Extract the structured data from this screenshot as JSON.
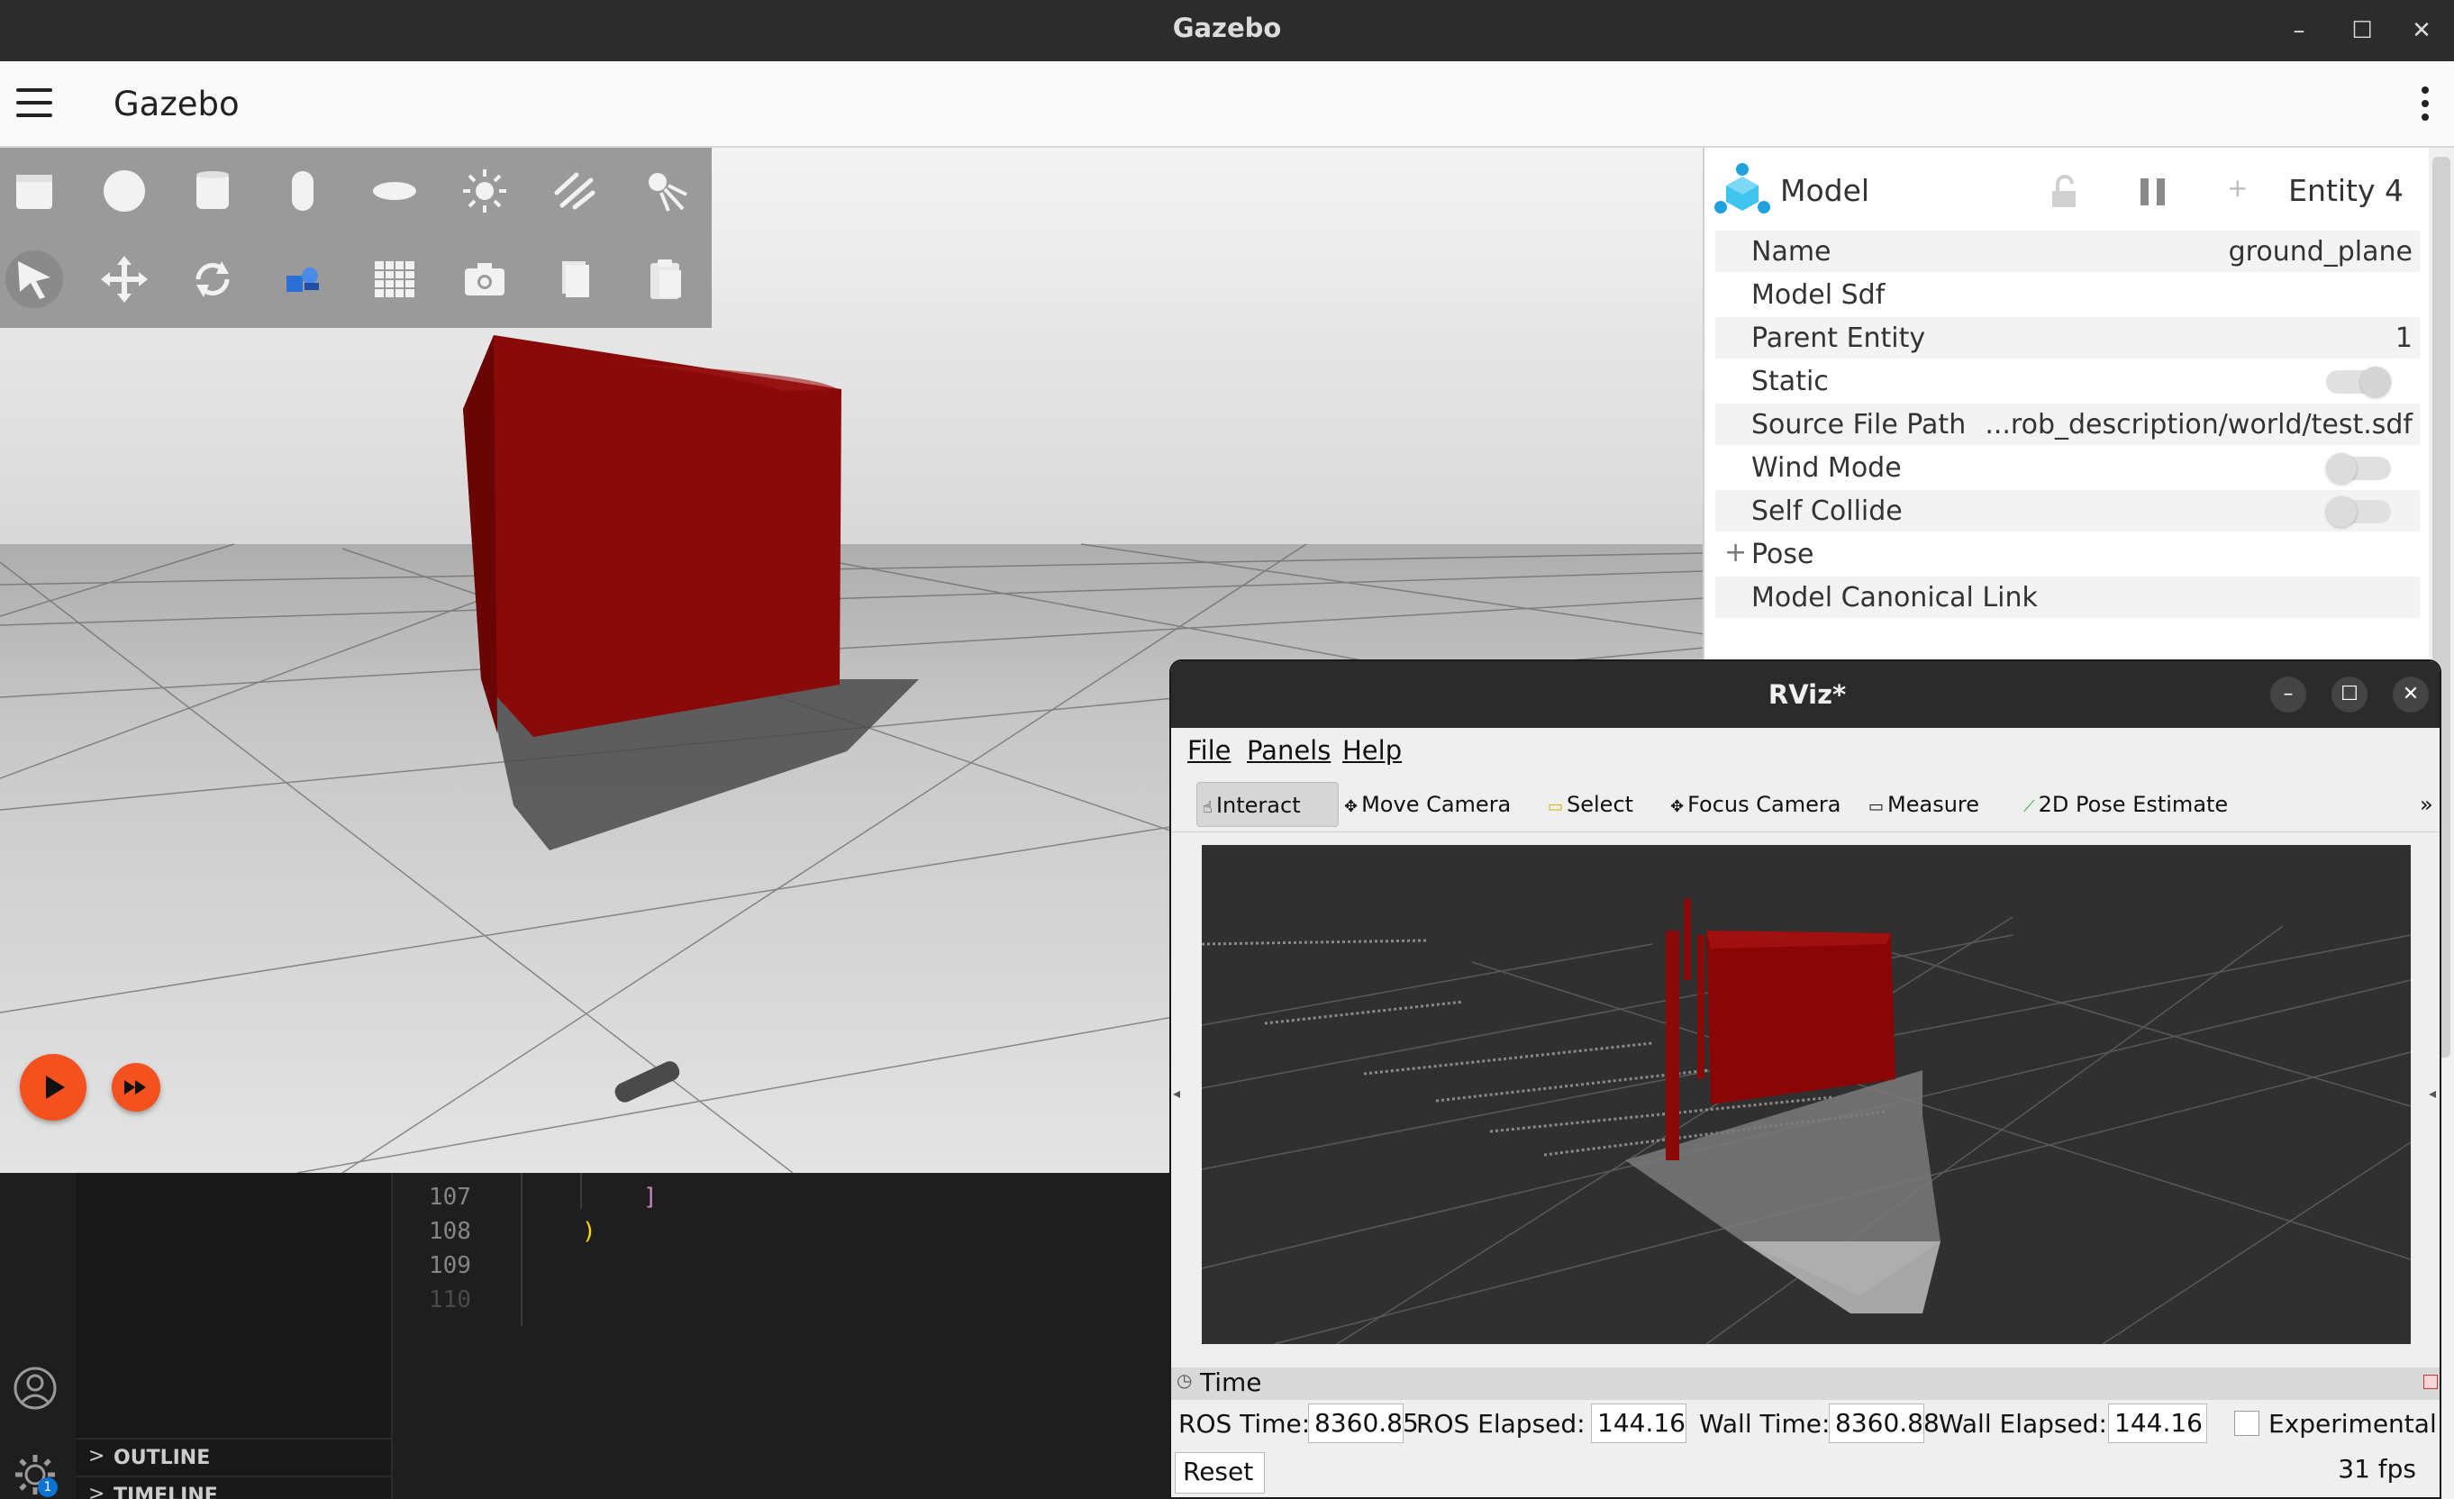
{
  "os_window": {
    "title": "Gazebo",
    "buttons": {
      "minimize": "–",
      "maximize": "☐",
      "close": "✕"
    }
  },
  "gazebo": {
    "app_title": "Gazebo",
    "toolbar_row1": [
      "box-icon",
      "sphere-icon",
      "cylinder-icon",
      "capsule-icon",
      "ellipsoid-icon",
      "sun-light-icon",
      "directional-light-icon",
      "spot-light-icon"
    ],
    "toolbar_row2": [
      "select-arrow-icon",
      "translate-icon",
      "rotate-icon",
      "transform-control-icon",
      "grid-icon",
      "screenshot-icon",
      "copy-icon",
      "paste-icon"
    ],
    "play": {
      "play_label": "▶",
      "step_label": "▸▸"
    },
    "accent_color": "#f4511e"
  },
  "entity_panel": {
    "header": {
      "type_label": "Model",
      "entity_label": "Entity 4",
      "add_label": "+"
    },
    "rows": [
      {
        "key": "Name",
        "value": "ground_plane"
      },
      {
        "key": "Model Sdf",
        "value": ""
      },
      {
        "key": "Parent Entity",
        "value": "1"
      },
      {
        "key": "Static",
        "value": ""
      },
      {
        "key": "Source File Path",
        "value": "...rob_description/world/test.sdf"
      },
      {
        "key": "Wind Mode",
        "value": ""
      },
      {
        "key": "Self Collide",
        "value": ""
      },
      {
        "key": "Pose",
        "value": ""
      },
      {
        "key": "Model Canonical Link",
        "value": ""
      }
    ],
    "pose_expander": "+",
    "toggles": {
      "static": true,
      "wind_mode": false,
      "self_collide": false
    }
  },
  "vscode": {
    "line_numbers": [
      "107",
      "108",
      "109",
      "110"
    ],
    "code_tokens": {
      "line107": "]",
      "line108": ")"
    },
    "sections": [
      {
        "chevron": ">",
        "label": "OUTLINE"
      },
      {
        "chevron": ">",
        "label": "TIMELINE"
      }
    ],
    "settings_badge": "1"
  },
  "rviz": {
    "title": "RViz*",
    "window_buttons": {
      "minimize": "–",
      "maximize": "☐",
      "close": "✕"
    },
    "menu": [
      "File",
      "Panels",
      "Help"
    ],
    "tools": [
      {
        "label": "Interact",
        "glyph": "☝"
      },
      {
        "label": "Move Camera",
        "glyph": "✥"
      },
      {
        "label": "Select",
        "glyph": "▭"
      },
      {
        "label": "Focus Camera",
        "glyph": "✥"
      },
      {
        "label": "Measure",
        "glyph": "▭"
      },
      {
        "label": "2D Pose Estimate",
        "glyph": "⟋"
      }
    ],
    "tools_overflow": "»",
    "time_panel": {
      "title": "Time",
      "ros_time_label": "ROS Time:",
      "ros_time": "8360.85",
      "ros_elapsed_label": "ROS Elapsed:",
      "ros_elapsed": "144.16",
      "wall_time_label": "Wall Time:",
      "wall_time": "8360.88",
      "wall_elapsed_label": "Wall Elapsed:",
      "wall_elapsed": "144.16",
      "experimental_label": "Experimental",
      "reset_label": "Reset",
      "fps": "31 fps"
    }
  }
}
